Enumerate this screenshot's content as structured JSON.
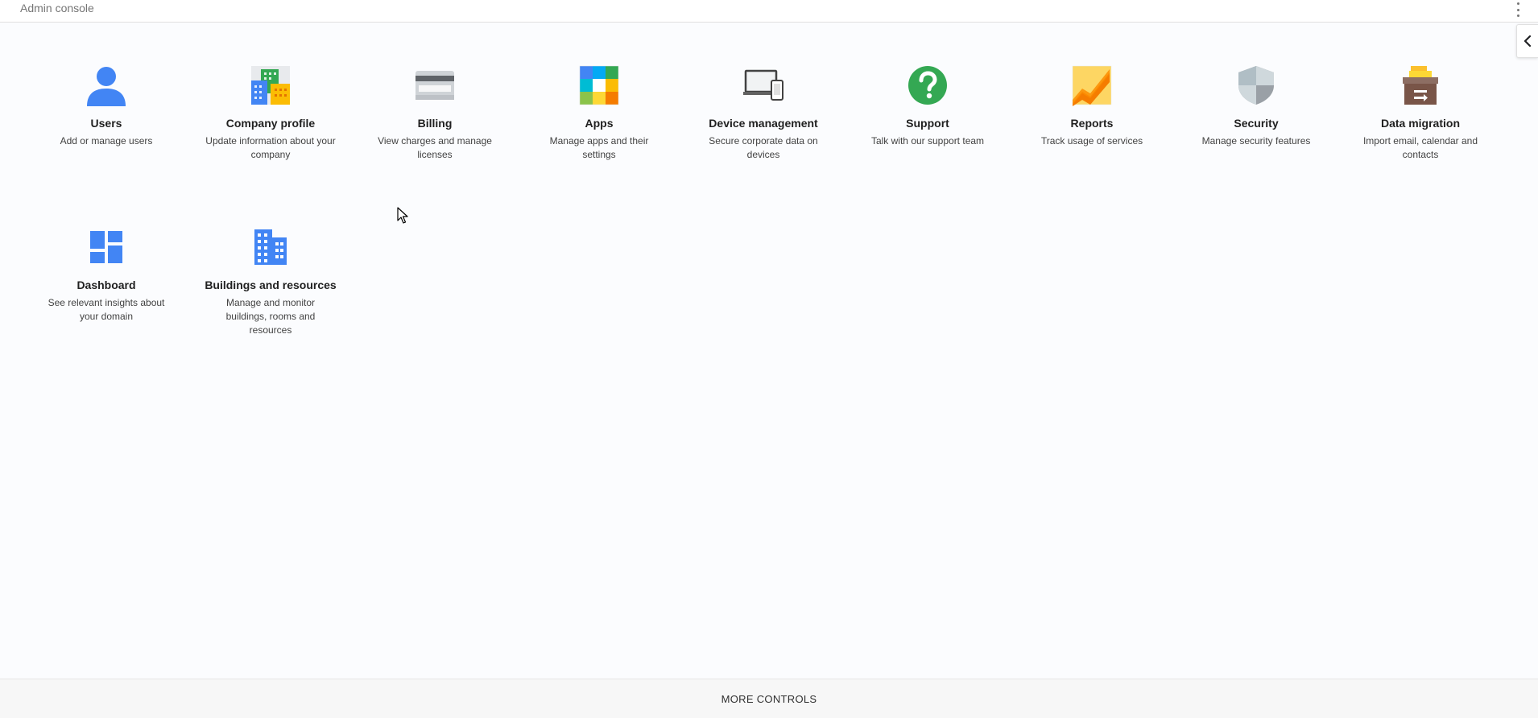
{
  "header": {
    "title": "Admin console",
    "menu_icon": "more-vert-icon",
    "collapse_icon": "chevron-left-icon"
  },
  "cards": [
    {
      "name": "Users",
      "desc": "Add or manage users",
      "icon": "user-icon"
    },
    {
      "name": "Company profile",
      "desc": "Update information about your company",
      "icon": "company-profile-icon"
    },
    {
      "name": "Billing",
      "desc": "View charges and manage licenses",
      "icon": "credit-card-icon"
    },
    {
      "name": "Apps",
      "desc": "Manage apps and their settings",
      "icon": "apps-grid-icon"
    },
    {
      "name": "Device management",
      "desc": "Secure corporate data on devices",
      "icon": "devices-icon"
    },
    {
      "name": "Support",
      "desc": "Talk with our support team",
      "icon": "help-icon"
    },
    {
      "name": "Reports",
      "desc": "Track usage of services",
      "icon": "reports-chart-icon"
    },
    {
      "name": "Security",
      "desc": "Manage security features",
      "icon": "shield-icon"
    },
    {
      "name": "Data migration",
      "desc": "Import email, calendar and contacts",
      "icon": "archive-box-icon"
    },
    {
      "name": "Dashboard",
      "desc": "See relevant insights about your domain",
      "icon": "dashboard-icon"
    },
    {
      "name": "Buildings and resources",
      "desc": "Manage and monitor buildings, rooms and resources",
      "icon": "building-icon"
    }
  ],
  "footer": {
    "label": "MORE CONTROLS"
  },
  "colors": {
    "accent_blue": "#4285f4",
    "support_green": "#34a853",
    "background": "#fbfcfe"
  }
}
